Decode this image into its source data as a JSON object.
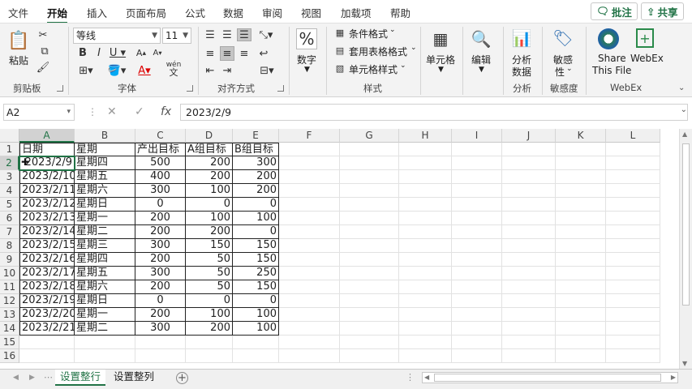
{
  "tabs": [
    "文件",
    "开始",
    "插入",
    "页面布局",
    "公式",
    "数据",
    "审阅",
    "视图",
    "加载项",
    "帮助"
  ],
  "active_tab": "开始",
  "comment_btn": "批注",
  "share_btn": "共享",
  "clipboard": {
    "paste": "粘贴",
    "group": "剪贴板"
  },
  "font": {
    "name": "等线",
    "size": "11",
    "group": "字体",
    "phonetic_top": "wén",
    "phonetic_bottom": "文"
  },
  "alignment": {
    "group": "对齐方式"
  },
  "number": {
    "label": "数字",
    "group": ""
  },
  "styles": {
    "conditional": "条件格式",
    "table": "套用表格格式",
    "cell": "单元格样式",
    "group": "样式"
  },
  "cells": {
    "label": "单元格"
  },
  "editing": {
    "label": "编辑"
  },
  "analysis": {
    "label1": "分析",
    "label2": "数据",
    "group": "分析"
  },
  "sensitivity": {
    "label1": "敏感",
    "label2": "性",
    "group": "敏感度"
  },
  "webex": {
    "share1": "Share",
    "share2": "This File",
    "webex": "WebEx",
    "group": "WebEx"
  },
  "name_box": "A2",
  "formula_value": "2023/2/9",
  "fx_label": "fx",
  "columns": [
    "A",
    "B",
    "C",
    "D",
    "E",
    "F",
    "G",
    "H",
    "I",
    "J",
    "K",
    "L"
  ],
  "rows": [
    "1",
    "2",
    "3",
    "4",
    "5",
    "6",
    "7",
    "8",
    "9",
    "10",
    "11",
    "12",
    "13",
    "14",
    "15",
    "16"
  ],
  "header_row": [
    "日期",
    "星期",
    "产出目标",
    "A组目标",
    "B组目标"
  ],
  "table": [
    [
      "2023/2/9",
      "星期四",
      "500",
      "200",
      "300"
    ],
    [
      "2023/2/10",
      "星期五",
      "400",
      "200",
      "200"
    ],
    [
      "2023/2/11",
      "星期六",
      "300",
      "100",
      "200"
    ],
    [
      "2023/2/12",
      "星期日",
      "0",
      "0",
      "0"
    ],
    [
      "2023/2/13",
      "星期一",
      "200",
      "100",
      "100"
    ],
    [
      "2023/2/14",
      "星期二",
      "200",
      "200",
      "0"
    ],
    [
      "2023/2/15",
      "星期三",
      "300",
      "150",
      "150"
    ],
    [
      "2023/2/16",
      "星期四",
      "200",
      "50",
      "150"
    ],
    [
      "2023/2/17",
      "星期五",
      "300",
      "50",
      "250"
    ],
    [
      "2023/2/18",
      "星期六",
      "200",
      "50",
      "150"
    ],
    [
      "2023/2/19",
      "星期日",
      "0",
      "0",
      "0"
    ],
    [
      "2023/2/20",
      "星期一",
      "200",
      "100",
      "100"
    ],
    [
      "2023/2/21",
      "星期二",
      "300",
      "200",
      "100"
    ]
  ],
  "sheets": [
    "设置整行",
    "设置整列"
  ],
  "active_sheet": "设置整行",
  "accent": "#217346"
}
